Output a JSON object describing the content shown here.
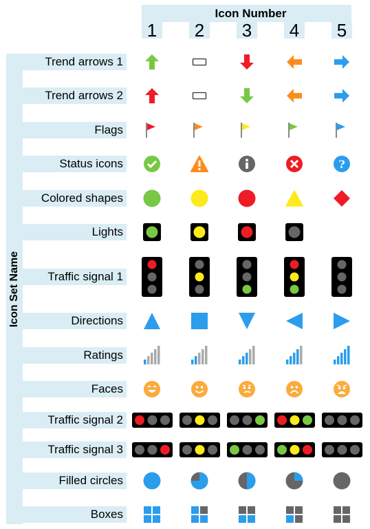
{
  "header": {
    "title": "Icon Number",
    "numbers": [
      "1",
      "2",
      "3",
      "4",
      "5"
    ]
  },
  "axis_label": "Icon Set Name",
  "colors": {
    "band": "#daedf4",
    "green": "#77c844",
    "red": "#ee1c25",
    "yellow": "#fcea1c",
    "orange": "#fd8c1e",
    "blue": "#2b9ded",
    "gray": "#666666",
    "lightgray": "#aaaaaa",
    "face": "#fbab3b",
    "black": "#000000"
  },
  "rows": [
    {
      "label": "Trend arrows 1",
      "icons": [
        "arrow-up-green",
        "flat-rectangle",
        "arrow-down-red",
        "arrow-left-orange",
        "arrow-right-blue"
      ]
    },
    {
      "label": "Trend arrows 2",
      "icons": [
        "arrow-up-red",
        "flat-rectangle",
        "arrow-down-green",
        "arrow-left-orange",
        "arrow-right-blue"
      ]
    },
    {
      "label": "Flags",
      "icons": [
        "flag-red",
        "flag-orange",
        "flag-yellow",
        "flag-green",
        "flag-blue"
      ]
    },
    {
      "label": "Status icons",
      "icons": [
        "check-circle-green",
        "warning-triangle-orange",
        "info-circle-gray",
        "x-circle-red",
        "question-circle-blue"
      ]
    },
    {
      "label": "Colored shapes",
      "icons": [
        "circle-green",
        "circle-yellow",
        "circle-red",
        "triangle-yellow",
        "diamond-red"
      ]
    },
    {
      "label": "Lights",
      "icons": [
        "light-green",
        "light-yellow",
        "light-red",
        "light-gray"
      ]
    },
    {
      "label": "Traffic signal 1",
      "icons": [
        "signal-vertical-red",
        "signal-vertical-yellow",
        "signal-vertical-green",
        "signal-vertical-all",
        "signal-vertical-off"
      ]
    },
    {
      "label": "Directions",
      "icons": [
        "triangle-up-blue",
        "square-blue",
        "triangle-down-blue",
        "triangle-left-blue",
        "triangle-right-blue"
      ]
    },
    {
      "label": "Ratings",
      "icons": [
        "rating-1-of-5",
        "rating-2-of-5",
        "rating-3-of-5",
        "rating-4-of-5",
        "rating-5-of-5"
      ]
    },
    {
      "label": "Faces",
      "icons": [
        "face-grin",
        "face-smile",
        "face-worried",
        "face-sad",
        "face-distressed"
      ]
    },
    {
      "label": "Traffic signal 2",
      "icons": [
        "signal-horizontal-red",
        "signal-horizontal-yellow",
        "signal-horizontal-green",
        "signal-horizontal-all",
        "signal-horizontal-off"
      ]
    },
    {
      "label": "Traffic signal 3",
      "icons": [
        "signal-horizontal-red-right",
        "signal-horizontal-yellow",
        "signal-horizontal-green-left",
        "signal-horizontal-all-reversed",
        "signal-horizontal-off"
      ]
    },
    {
      "label": "Filled circles",
      "icons": [
        "pie-full",
        "pie-three-quarters",
        "pie-half",
        "pie-one-quarter",
        "pie-empty"
      ]
    },
    {
      "label": "Boxes",
      "icons": [
        "boxes-4-of-4",
        "boxes-3-of-4",
        "boxes-2-of-4",
        "boxes-1-of-4",
        "boxes-0-of-4"
      ]
    }
  ],
  "signals": {
    "traffic1": [
      [
        "red",
        "off",
        "off"
      ],
      [
        "off",
        "yellow",
        "off"
      ],
      [
        "off",
        "off",
        "green"
      ],
      [
        "red",
        "yellow",
        "green"
      ],
      [
        "off",
        "off",
        "off"
      ]
    ],
    "traffic2": [
      [
        "red",
        "off",
        "off"
      ],
      [
        "off",
        "yellow",
        "off"
      ],
      [
        "off",
        "off",
        "green"
      ],
      [
        "red",
        "yellow",
        "green"
      ],
      [
        "off",
        "off",
        "off"
      ]
    ],
    "traffic3": [
      [
        "off",
        "off",
        "red"
      ],
      [
        "off",
        "yellow",
        "off"
      ],
      [
        "green",
        "off",
        "off"
      ],
      [
        "green",
        "yellow",
        "red"
      ],
      [
        "off",
        "off",
        "off"
      ]
    ]
  },
  "ratings_filled": [
    1,
    2,
    3,
    4,
    5
  ],
  "pie_fill_fraction": [
    1.0,
    0.75,
    0.5,
    0.25,
    0.0
  ],
  "boxes_filled": [
    4,
    3,
    2,
    1,
    0
  ]
}
